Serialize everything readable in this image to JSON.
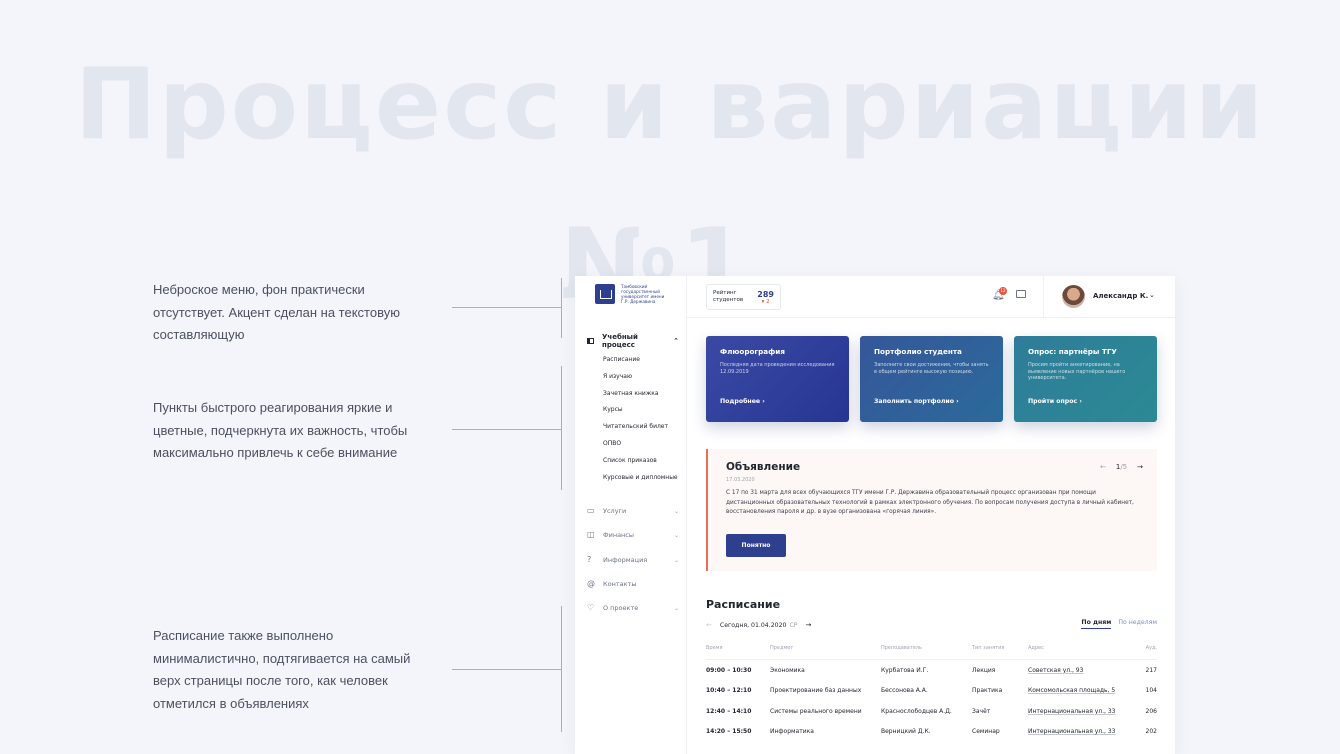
{
  "background_title": {
    "line1": "Процесс и вариации",
    "line2": "№1"
  },
  "annotations": [
    "Неброское меню, фон практически отсутствует. Акцент сделан на текстовую составляющую",
    "Пункты быстрого реагирования яркие и цветные, подчеркнута их важность, чтобы максимально привлечь к себе внимание",
    "Расписание также выполнено минималистично, подтягивается на самый верх страницы после того, как человек отметился в объявлениях"
  ],
  "logo": {
    "text": "Тамбовский государственный университет имени Г.Р. Державина",
    "icon": "university-emblem-icon"
  },
  "sidebar": {
    "group": {
      "label": "Учебный процесс",
      "icon": "book-icon",
      "items": [
        "Расписание",
        "Я изучаю",
        "Зачетная книжка",
        "Курсы",
        "Читательский билет",
        "ОПВО",
        "Список приказов",
        "Курсовые и дипломные"
      ]
    },
    "items": [
      {
        "label": "Услуги",
        "icon": "briefcase-icon",
        "chevron": true
      },
      {
        "label": "Финансы",
        "icon": "wallet-icon",
        "chevron": true
      },
      {
        "label": "Информация",
        "icon": "help-circle-icon",
        "chevron": true
      },
      {
        "label": "Контакты",
        "icon": "at-icon",
        "chevron": false
      },
      {
        "label": "О проекте",
        "icon": "heart-icon",
        "chevron": true
      }
    ]
  },
  "topbar": {
    "rating_label": "Рейтинг студентов",
    "rating_value": "289",
    "rating_delta": "▾ 2",
    "notifications_count": "12",
    "user_name": "Александр К."
  },
  "cards": [
    {
      "title": "Флюорография",
      "text": "Последняя дата проведения исследования 12.09.2019",
      "link": "Подробнее"
    },
    {
      "title": "Портфолио студента",
      "text": "Заполните свои достижения, чтобы занять в общем рейтинге высокую позицию.",
      "link": "Заполнить портфолио"
    },
    {
      "title": "Опрос: партнёры ТГУ",
      "text": "Просим пройти анкетирование, на выявление новых партнёров нашего университета.",
      "link": "Пройти опрос"
    }
  ],
  "announcement": {
    "title": "Объявление",
    "date": "17.03.2020",
    "body": "С 17 по 31 марта для всех обучающихся ТГУ имени Г.Р. Державина образовательный процесс организован при помощи дистанционных образовательных технологий в рамках электронного обучения. По вопросам получения доступа в личный кабинет, восстановления пароля и др. в вузе организована «горячая линия».",
    "button": "Понятно",
    "page": "1",
    "total": "/5"
  },
  "schedule": {
    "title": "Расписание",
    "today": "Сегодня, 01.04.2020",
    "weekday": "СР",
    "view_days": "По дням",
    "view_weeks": "По неделям",
    "columns": [
      "Время",
      "Предмет",
      "Преподаватель",
      "Тип занятия",
      "Адрес",
      "Ауд."
    ],
    "rows": [
      [
        "09:00 – 10:30",
        "Экономика",
        "Курбатова И.Г.",
        "Лекция",
        "Советская ул., 93",
        "217"
      ],
      [
        "10:40 – 12:10",
        "Проектирование баз данных",
        "Бессонова А.А.",
        "Практика",
        "Комсомольская площадь, 5",
        "104"
      ],
      [
        "12:40 – 14:10",
        "Системы реального времени",
        "Краснослободцев А.Д.",
        "Зачёт",
        "Интернациональная ул., 33",
        "206"
      ],
      [
        "14:20 – 15:50",
        "Информатика",
        "Верницкий Д.К.",
        "Семинар",
        "Интернациональная ул., 33",
        "202"
      ]
    ]
  }
}
